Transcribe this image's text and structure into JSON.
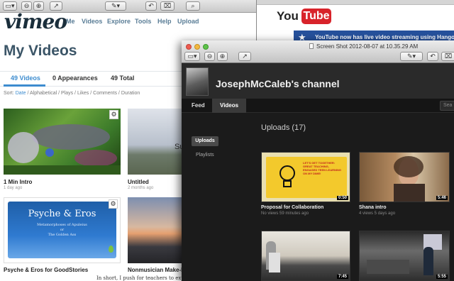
{
  "vimeo": {
    "logo": "vimeo",
    "nav": [
      "Me",
      "Videos",
      "Explore",
      "Tools",
      "Help",
      "Upload"
    ],
    "page_title": "My Videos",
    "stats": [
      {
        "label": "49 Videos"
      },
      {
        "label": "0 Appearances"
      },
      {
        "label": "49 Total"
      }
    ],
    "sort_label": "Sort:",
    "sort_options": [
      "Date",
      "Alphabetical",
      "Plays",
      "Likes",
      "Comments",
      "Duration"
    ],
    "sort_separator": " / ",
    "videos": [
      {
        "title": "1 Min Intro",
        "meta": "1 day ago"
      },
      {
        "title": "Untitled",
        "meta": "2 months ago"
      },
      {
        "title": "Psyche & Eros for GoodStories",
        "meta": ""
      },
      {
        "title": "Nonmusician Make-B",
        "meta": ""
      }
    ],
    "psyche_thumb": {
      "title": "Psyche & Eros",
      "line1": "Metamorphoses of Apuleius",
      "line2": "or",
      "line3": "The Golden Ass"
    },
    "partial_thumb_text": "Su",
    "footer_text": "In short, I push for teachers to expe"
  },
  "youtube_back": {
    "logo_you": "You",
    "logo_tube": "Tube",
    "banner": "YouTube now has live video streaming using Hangouts on"
  },
  "preview": {
    "window_title": "Screen Shot 2012-08-07 at 10.35.29 AM",
    "channel_title": "JosephMcCaleb's channel",
    "tabs": [
      "Feed",
      "Videos"
    ],
    "search_placeholder": "Sea",
    "sidebar": [
      "Uploads",
      "Playlists"
    ],
    "uploads_heading": "Uploads (17)",
    "uploads": [
      {
        "title": "Proposal for Collaboration",
        "meta": "No views 59 minutes ago",
        "duration": "0:50"
      },
      {
        "title": "Shana intro",
        "meta": "4 views 5 days ago",
        "duration": "5:46"
      },
      {
        "title": "",
        "meta": "",
        "duration": "7:45"
      },
      {
        "title": "",
        "meta": "",
        "duration": "5:55"
      }
    ],
    "note_text": "LET'S GET TOGETHER: GREAT TEACHING, ENGAGED TEEN LEARNING ON MY DIME!"
  },
  "colors": {
    "vimeo_blue": "#3d8ccf",
    "youtube_red": "#d8232a",
    "banner_blue": "#26519c",
    "dark_bg": "#1b1b1b"
  }
}
